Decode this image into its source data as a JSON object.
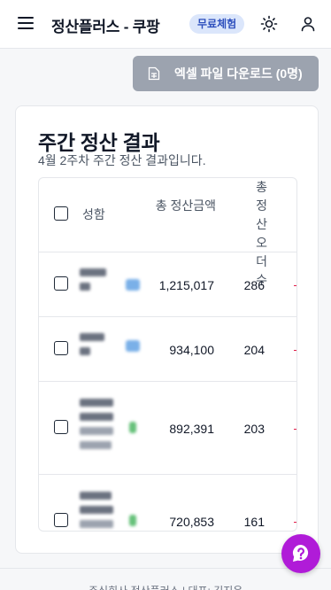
{
  "header": {
    "brand": "정산플러스 - 쿠팡",
    "badge": "무료체험"
  },
  "toolbar": {
    "download_label": "엑셀 파일 다운로드 (0명)"
  },
  "card": {
    "title": "주간 정산 결과",
    "subtitle": "4월 2주차 주간 정산 결과입니다."
  },
  "table": {
    "columns": [
      "성함",
      "총 정산금액",
      "총 정산 오더 수"
    ],
    "rows": [
      {
        "amount": "1,215,017",
        "orders": "286"
      },
      {
        "amount": "934,100",
        "orders": "204"
      },
      {
        "amount": "892,391",
        "orders": "203"
      },
      {
        "amount": "720,853",
        "orders": "161"
      }
    ]
  },
  "footer": {
    "text": "주식회사 정산플러스 | 대표: 김지윤"
  },
  "colors": {
    "badge_bg": "#dbe6fb",
    "badge_text": "#2d4fbd",
    "download_bg": "#9ca3af",
    "help_fab": "#b01bd8",
    "negative_mark": "#e11d48"
  },
  "icons": [
    "menu-icon",
    "sun-icon",
    "user-icon",
    "spreadsheet-icon",
    "help-icon"
  ]
}
